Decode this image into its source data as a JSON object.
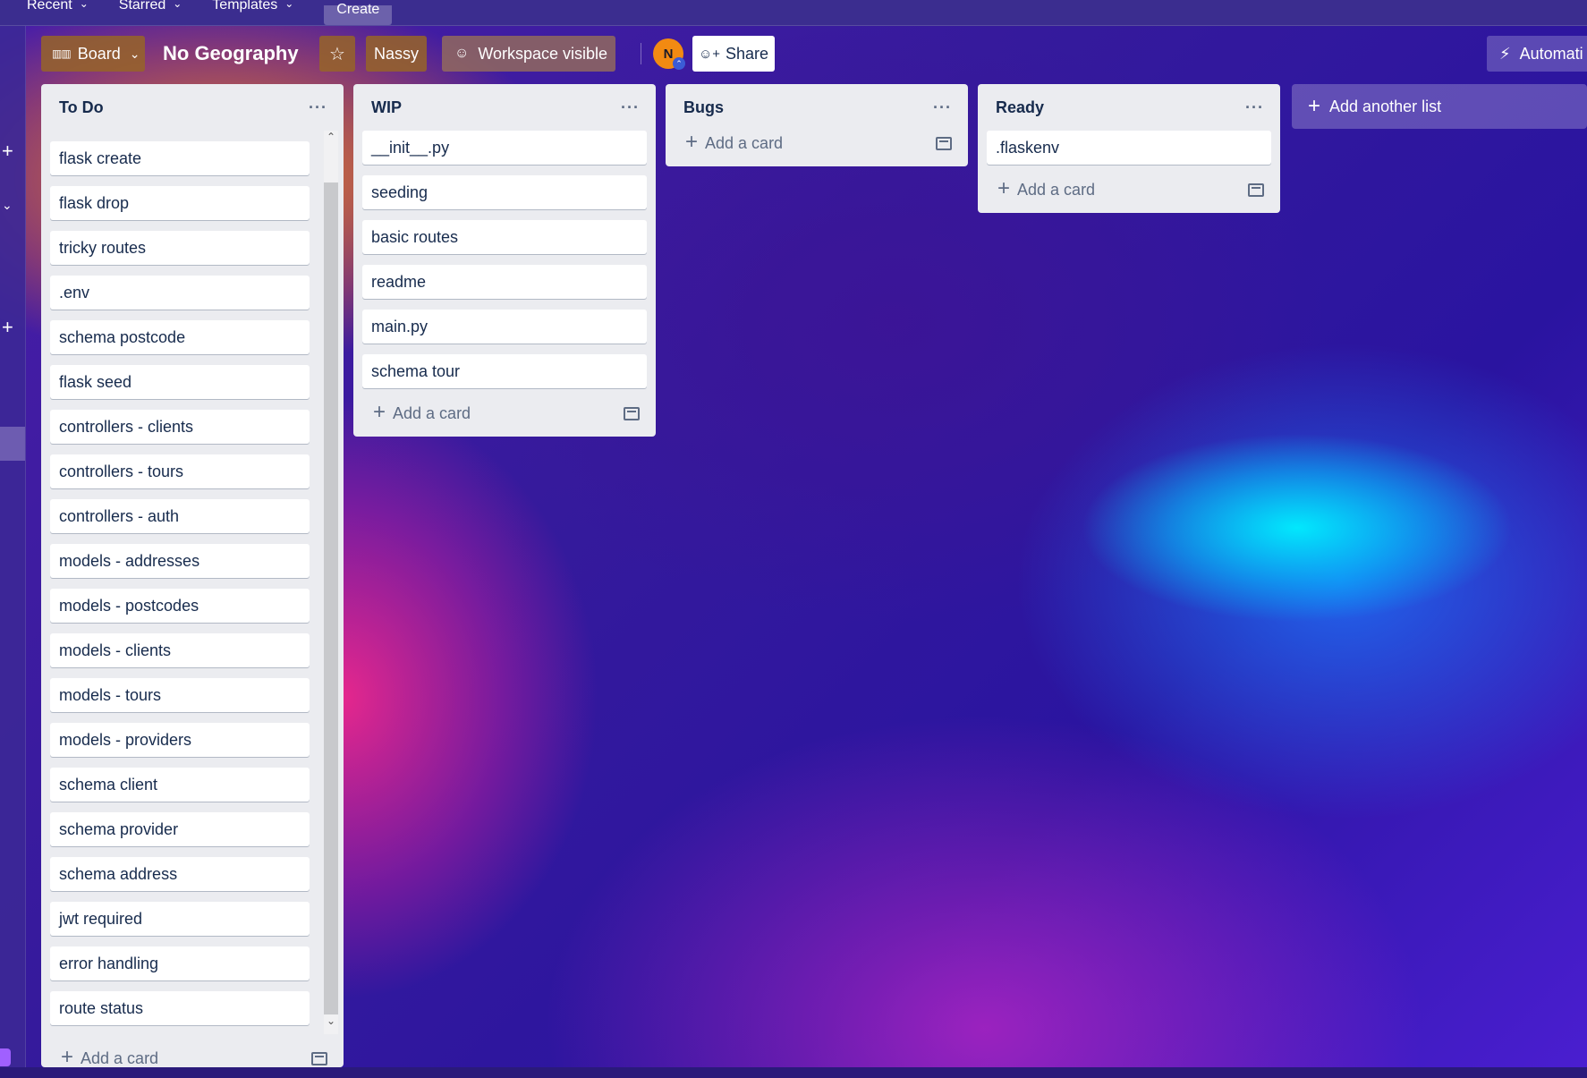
{
  "topnav": {
    "recent_label": "Recent",
    "starred_label": "Starred",
    "templates_label": "Templates",
    "create_label": "Create"
  },
  "header": {
    "view_label": "Board",
    "board_title": "No Geography",
    "workspace_name": "Nassy",
    "visibility_label": "Workspace visible",
    "avatar_initial": "N",
    "share_label": "Share",
    "automation_label": "Automati"
  },
  "lists": {
    "todo": {
      "title": "To Do",
      "menu": "···",
      "cards": [
        "flask create",
        "flask drop",
        "tricky routes",
        ".env",
        "schema postcode",
        "flask seed",
        "controllers - clients",
        "controllers - tours",
        "controllers - auth",
        "models - addresses",
        "models - postcodes",
        "models - clients",
        "models - tours",
        "models - providers",
        "schema client",
        "schema provider",
        "schema address",
        "jwt required",
        "error handling",
        "route status"
      ],
      "add_card_label": "Add a card"
    },
    "wip": {
      "title": "WIP",
      "menu": "···",
      "cards": [
        "__init__.py",
        "seeding",
        "basic routes",
        "readme",
        "main.py",
        "schema tour"
      ],
      "add_card_label": "Add a card"
    },
    "bugs": {
      "title": "Bugs",
      "menu": "···",
      "cards": [],
      "add_card_label": "Add a card"
    },
    "ready": {
      "title": "Ready",
      "menu": "···",
      "cards": [
        ".flaskenv"
      ],
      "add_card_label": "Add a card"
    }
  },
  "add_list_label": "Add another list",
  "colors": {
    "avatar": "#f28a12",
    "list_bg": "#ebecf0",
    "text": "#172b4d"
  }
}
